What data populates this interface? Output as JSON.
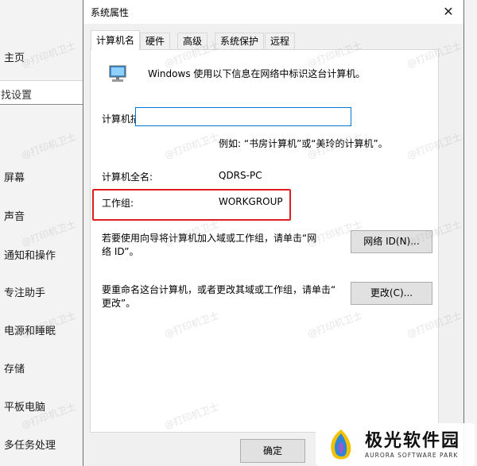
{
  "settings_nav": {
    "home": "主页",
    "search_placeholder": "找设置",
    "items": [
      "屏幕",
      "声音",
      "通知和操作",
      "专注助手",
      "电源和睡眠",
      "存储",
      "平板电脑",
      "多任务处理"
    ]
  },
  "dialog": {
    "title": "系统属性",
    "close_glyph": "✕",
    "tabs": [
      "计算机名",
      "硬件",
      "高级",
      "系统保护",
      "远程"
    ],
    "active_tab": "计算机名",
    "intro": "Windows 使用以下信息在网络中标识这台计算机。",
    "description_label": "计算机描述(D):",
    "description_value": "",
    "example_text": "例如: “书房计算机”或“美玲的计算机”。",
    "full_name_label": "计算机全名:",
    "full_name_value": "QDRS-PC",
    "workgroup_label": "工作组:",
    "workgroup_value": "WORKGROUP",
    "network_text_1": "若要使用向导将计算机加入域或工作组，请单击“网",
    "network_text_2": "络 ID”。",
    "network_button": "网络 ID(N)...",
    "rename_text_1": "要重命名这台计算机，或者更改其域或工作组，请单击“",
    "rename_text_2": "更改”。",
    "change_button": "更改(C)...",
    "ok_button": "确定"
  },
  "watermark": "@打印机卫士",
  "logo": {
    "name": "极光软件园",
    "subtitle": "AURORA SOFTWARE PARK"
  },
  "colors": {
    "highlight": "#e02020",
    "input_border": "#0078d7"
  }
}
